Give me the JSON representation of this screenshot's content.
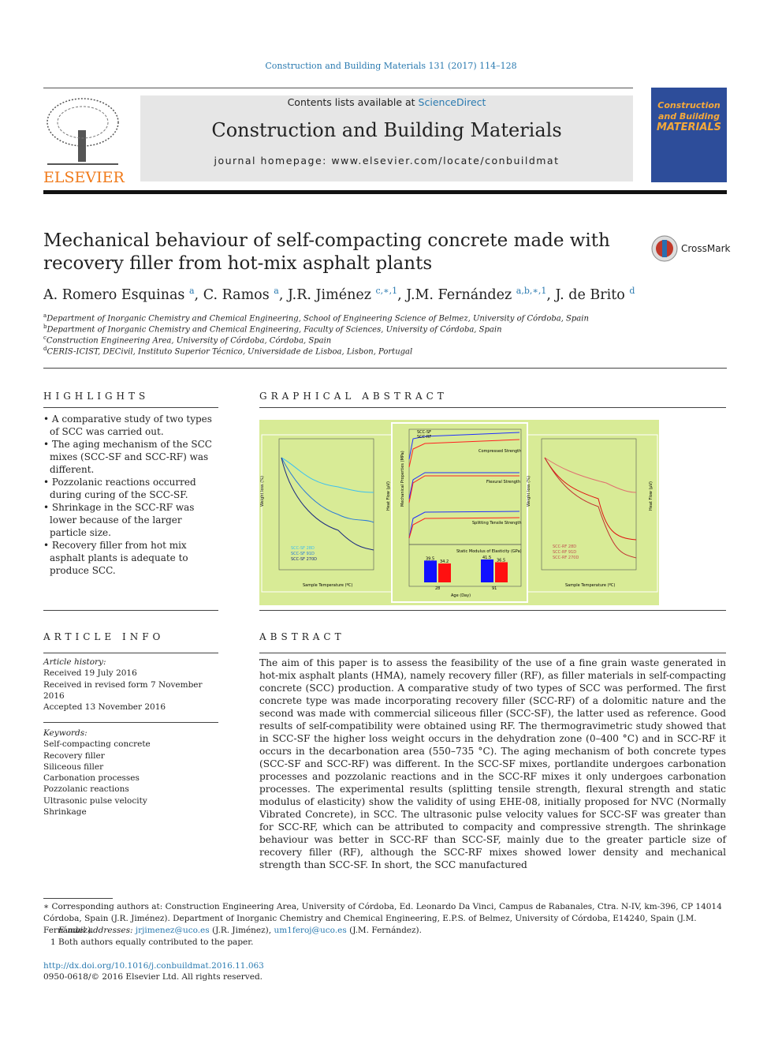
{
  "journal_ref": "Construction and Building Materials 131 (2017) 114–128",
  "banner": {
    "contents_prefix": "Contents lists available at ",
    "contents_link": "ScienceDirect",
    "journal_title": "Construction and Building Materials",
    "homepage": "journal homepage: www.elsevier.com/locate/conbuildmat"
  },
  "publisher_logo": "ELSEVIER",
  "cover": {
    "line1": "Construction",
    "line2": "and Building",
    "line3": "MATERIALS"
  },
  "title": "Mechanical behaviour of self-compacting concrete made with recovery filler from hot-mix asphalt plants",
  "crossmark": "CrossMark",
  "authors": [
    {
      "name": "A. Romero Esquinas",
      "sup": "a"
    },
    {
      "name": "C. Ramos",
      "sup": "a"
    },
    {
      "name": "J.R. Jiménez",
      "sup": "c,∗,1"
    },
    {
      "name": "J.M. Fernández",
      "sup": "a,b,∗,1"
    },
    {
      "name": "J. de Brito",
      "sup": "d"
    }
  ],
  "affiliations": [
    {
      "key": "a",
      "text": "Department of Inorganic Chemistry and Chemical Engineering, School of Engineering Science of Belmez, University of Córdoba, Spain"
    },
    {
      "key": "b",
      "text": "Department of Inorganic Chemistry and Chemical Engineering, Faculty of Sciences, University of Córdoba, Spain"
    },
    {
      "key": "c",
      "text": "Construction Engineering Area, University of Córdoba, Córdoba, Spain"
    },
    {
      "key": "d",
      "text": "CERIS-ICIST, DECivil, Instituto Superior Técnico, Universidade de Lisboa, Lisbon, Portugal"
    }
  ],
  "highlights": {
    "heading": "HIGHLIGHTS",
    "items": [
      "A comparative study of two types of SCC was carried out.",
      "The aging mechanism of the SCC mixes (SCC-SF and SCC-RF) was different.",
      "Pozzolanic reactions occurred during curing of the SCC-SF.",
      "Shrinkage in the SCC-RF was lower because of the larger particle size.",
      "Recovery filler from hot mix asphalt plants is adequate to produce SCC."
    ]
  },
  "graphical_abstract": {
    "heading": "GRAPHICAL ABSTRACT",
    "left": {
      "ylabel": "Weight loss (%)",
      "y2label": "Heat Flow (µV)",
      "xlabel": "Sample Temperature (ºC)",
      "legend": [
        "SCC-SF 28D",
        "SCC-SF 91D",
        "SCC-SF 270D"
      ],
      "colors": [
        "#3cc0f0",
        "#2a7ad8",
        "#1a2a80"
      ]
    },
    "center": {
      "ylabel": "Mechanical Properties (MPa)",
      "xlabel": "Age (Day)",
      "x2label": "Static Modulus of Elasticity (GPa)",
      "legend": [
        "SCC-SF",
        "SCC-RF"
      ],
      "labels": [
        "Compressed Strength",
        "Flexural Strength",
        "Splitting Tensile Strength"
      ],
      "bars": {
        "categories": [
          "28",
          "91"
        ],
        "SCC-SF": [
          39.5,
          41.5
        ],
        "SCC-RF": [
          34.2,
          36.5
        ]
      }
    },
    "right": {
      "ylabel": "Weight loss (%)",
      "y2label": "Heat Flow (µV)",
      "xlabel": "Sample Temperature (ºC)",
      "legend": [
        "SCC-RF 28D",
        "SCC-RF 91D",
        "SCC-RF 270D"
      ],
      "colors": [
        "#e07070",
        "#e01010",
        "#c03030"
      ]
    }
  },
  "article_info": {
    "heading": "ARTICLE INFO",
    "history_label": "Article history:",
    "history": [
      "Received 19 July 2016",
      "Received in revised form 7 November 2016",
      "Accepted 13 November 2016"
    ],
    "keywords_label": "Keywords:",
    "keywords": [
      "Self-compacting concrete",
      "Recovery filler",
      "Siliceous filler",
      "Carbonation processes",
      "Pozzolanic reactions",
      "Ultrasonic pulse velocity",
      "Shrinkage"
    ]
  },
  "abstract": {
    "heading": "ABSTRACT",
    "text": "The aim of this paper is to assess the feasibility of the use of a fine grain waste generated in hot-mix asphalt plants (HMA), namely recovery filler (RF), as filler materials in self-compacting concrete (SCC) production. A comparative study of two types of SCC was performed. The first concrete type was made incorporating recovery filler (SCC-RF) of a dolomitic nature and the second was made with commercial siliceous filler (SCC-SF), the latter used as reference. Good results of self-compatibility were obtained using RF. The thermogravimetric study showed that in SCC-SF the higher loss weight occurs in the dehydration zone (0–400 °C) and in SCC-RF it occurs in the decarbonation area (550–735 °C). The aging mechanism of both concrete types (SCC-SF and SCC-RF) was different. In the SCC-SF mixes, portlandite undergoes carbonation processes and pozzolanic reactions and in the SCC-RF mixes it only undergoes carbonation processes. The experimental results (splitting tensile strength, flexural strength and static modulus of elasticity) show the validity of using EHE-08, initially proposed for NVC (Normally Vibrated Concrete), in SCC. The ultrasonic pulse velocity values for SCC-SF was greater than for SCC-RF, which can be attributed to compacity and compressive strength. The shrinkage behaviour was better in SCC-RF than SCC-SF, mainly due to the greater particle size of recovery filler (RF), although the SCC-RF mixes showed lower density and mechanical strength than SCC-SF. In short, the SCC manufactured"
  },
  "footnotes": {
    "corresponding": "∗ Corresponding authors at: Construction Engineering Area, University of Córdoba, Ed. Leonardo Da Vinci, Campus de Rabanales, Ctra. N-IV, km-396, CP 14014 Córdoba, Spain (J.R. Jiménez). Department of Inorganic Chemistry and Chemical Engineering, E.P.S. of Belmez, University of Córdoba, E14240, Spain (J.M. Fernández).",
    "email_label": "E-mail addresses:",
    "email1": "jrjimenez@uco.es",
    "email1_who": " (J.R. Jiménez), ",
    "email2": "um1feroj@uco.es",
    "email2_who": " (J.M. Fernández).",
    "equal": "1  Both authors equally contributed to the paper."
  },
  "doi": "http://dx.doi.org/10.1016/j.conbuildmat.2016.11.063",
  "copyright": "0950-0618/© 2016 Elsevier Ltd. All rights reserved."
}
